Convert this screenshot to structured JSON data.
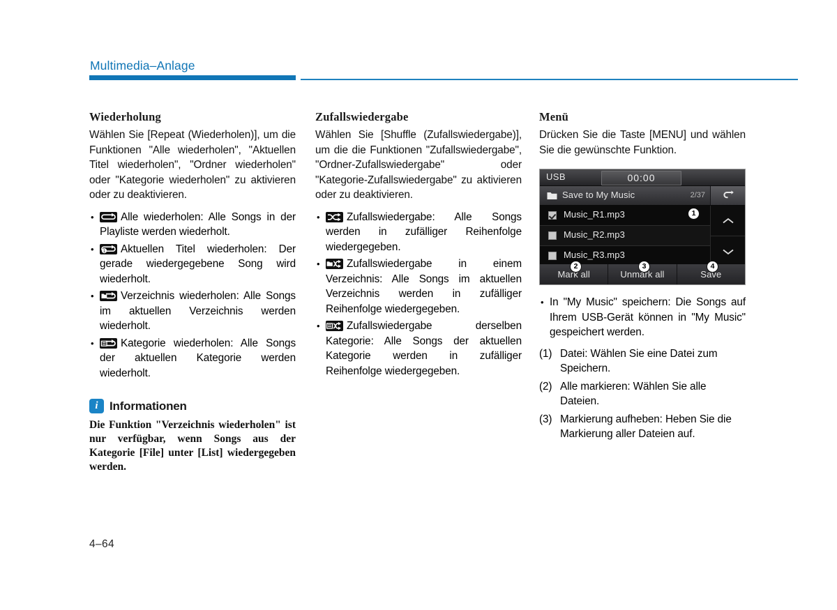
{
  "header": {
    "title": "Multimedia–Anlage",
    "accent_color": "#1176b6"
  },
  "page_number": "4–64",
  "columns": {
    "repeat": {
      "title": "Wiederholung",
      "intro": "Wählen Sie [Repeat (Wiederholen)], um die Funktionen \"Alle wiederholen\", \"Aktuellen Titel wiederholen\", \"Ordner wiederholen\" oder \"Kategorie wiederholen\" zu aktivieren oder zu deaktivieren.",
      "items": [
        {
          "icon": "repeat-all-icon",
          "text": "Alle wiederholen: Alle Songs in der Playliste werden wiederholt."
        },
        {
          "icon": "repeat-one-icon",
          "text": "Aktuellen Titel wiederholen: Der gerade wiedergegebene Song wird wiederholt."
        },
        {
          "icon": "repeat-folder-icon",
          "text": "Verzeichnis wiederholen: Alle Songs im aktuellen Verzeichnis werden wiederholt."
        },
        {
          "icon": "repeat-category-icon",
          "text": "Kategorie wiederholen: Alle Songs der aktuellen Kategorie werden wiederholt."
        }
      ],
      "info": {
        "icon": "info-icon",
        "icon_letter": "i",
        "title": "Informationen",
        "text": "Die Funktion \"Verzeichnis wiederholen\" ist nur verfügbar, wenn Songs aus der Kategorie [File] unter [List] wiedergegeben werden."
      }
    },
    "shuffle": {
      "title": "Zufallswiedergabe",
      "intro": "Wählen Sie [Shuffle (Zufallswiedergabe)], um die die Funktionen \"Zufallswiedergabe\", \"Ordner-Zufallswiedergabe\" oder \"Kategorie-Zufallswiedergabe\" zu aktivieren oder zu deaktivieren.",
      "items": [
        {
          "icon": "shuffle-all-icon",
          "text": "Zufallswiedergabe: Alle Songs werden in zufälliger Reihenfolge wiedergegeben."
        },
        {
          "icon": "shuffle-folder-icon",
          "text": "Zufallswiedergabe in einem Verzeichnis: Alle Songs im aktuellen Verzeichnis werden in zufälliger Reihenfolge wiedergegeben."
        },
        {
          "icon": "shuffle-category-icon",
          "text": "Zufallswiedergabe derselben Kategorie: Alle Songs der aktuellen Kategorie werden in zufälliger Reihenfolge wiedergegeben."
        }
      ]
    },
    "menu": {
      "title": "Menü",
      "intro": "Drücken Sie die Taste [MENU] und wählen Sie die gewünschte Funktion.",
      "device": {
        "source_label": "USB",
        "clock": "00:00",
        "nav_title": "Save to My Music",
        "nav_count": "2/37",
        "back_icon": "back-arrow-icon",
        "folder_icon": "folder-icon",
        "rows": [
          {
            "label": "Music_R1.mp3",
            "checked": true
          },
          {
            "label": "Music_R2.mp3",
            "checked": false
          },
          {
            "label": "Music_R3.mp3",
            "checked": false
          }
        ],
        "scroll_up_icon": "chevron-up-icon",
        "scroll_down_icon": "chevron-down-icon",
        "buttons": [
          {
            "label": "Mark all"
          },
          {
            "label": "Unmark all"
          },
          {
            "label": "Save"
          }
        ],
        "callouts": [
          "1",
          "2",
          "3",
          "4"
        ]
      },
      "bullets": [
        "In \"My Music\" speichern: Die Songs auf Ihrem USB-Gerät können in \"My Music\" gespeichert werden."
      ],
      "numbered": [
        {
          "num": "(1)",
          "text": "Datei: Wählen Sie eine Datei zum Speichern."
        },
        {
          "num": "(2)",
          "text": "Alle markieren: Wählen Sie alle Dateien."
        },
        {
          "num": "(3)",
          "text": "Markierung aufheben: Heben Sie die Markierung aller Dateien auf."
        }
      ]
    }
  }
}
